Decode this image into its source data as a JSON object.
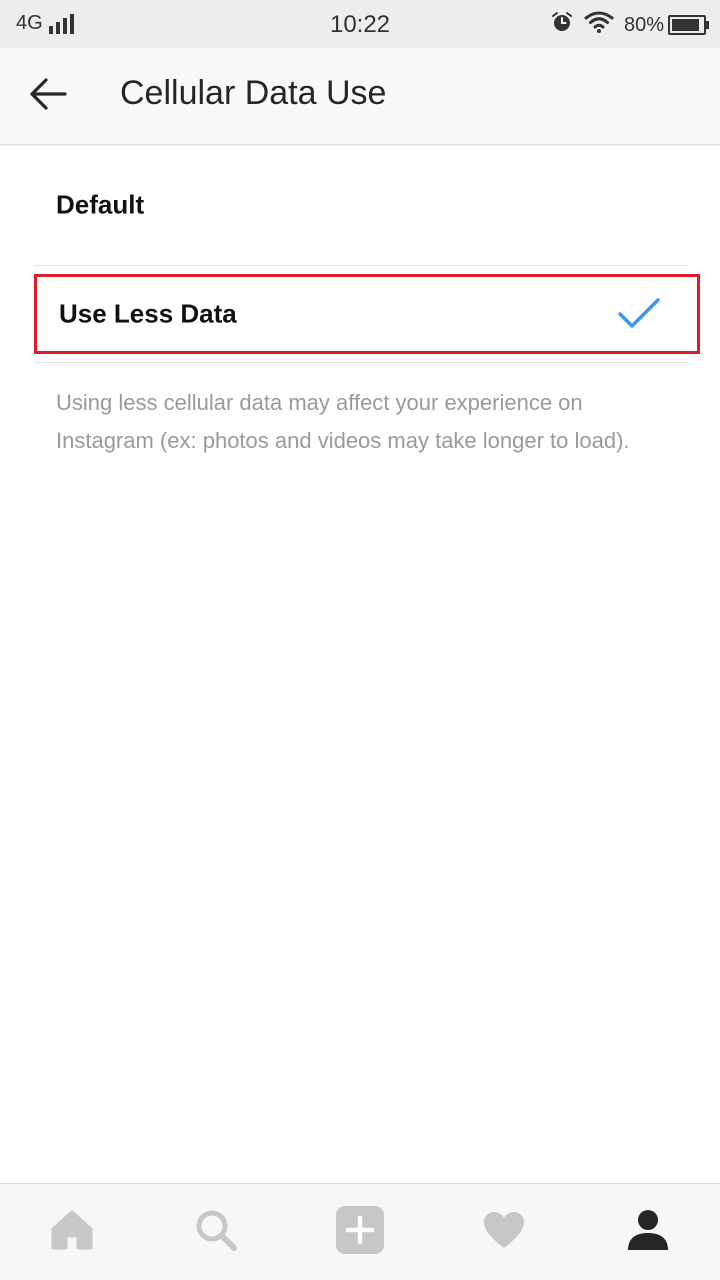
{
  "status_bar": {
    "network": "4G",
    "time": "10:22",
    "battery_percent": "80%"
  },
  "header": {
    "title": "Cellular Data Use",
    "back_icon": "arrow-left-icon"
  },
  "options": [
    {
      "label": "Default",
      "selected": false
    },
    {
      "label": "Use Less Data",
      "selected": true
    }
  ],
  "description": "Using less cellular data may affect your experience on Instagram (ex: photos and videos may take longer to load).",
  "colors": {
    "check": "#3897f0",
    "highlight_border": "#dc1d2c",
    "description": "#9a9a9a",
    "nav_icon_inactive": "#c7c7c7",
    "nav_icon_active": "#262626"
  },
  "bottom_nav": [
    {
      "icon": "home-icon",
      "active": false
    },
    {
      "icon": "search-icon",
      "active": false
    },
    {
      "icon": "add-post-icon",
      "active": false
    },
    {
      "icon": "heart-icon",
      "active": false
    },
    {
      "icon": "profile-icon",
      "active": true
    }
  ]
}
